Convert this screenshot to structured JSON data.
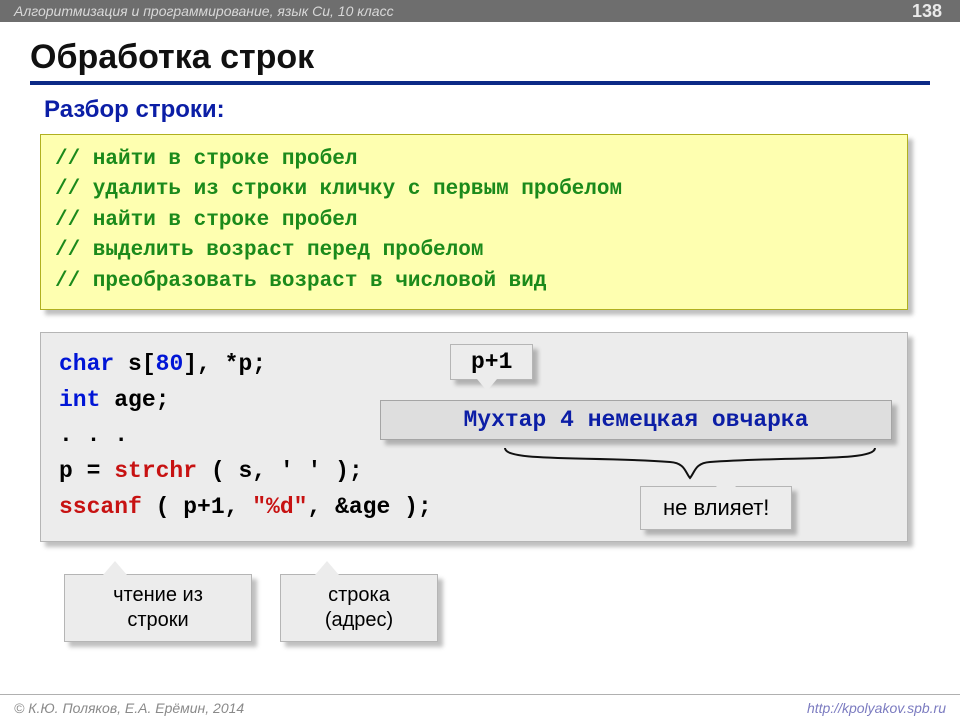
{
  "topbar": {
    "course": "Алгоритмизация и программирование, язык Си, 10 класс",
    "slidenum": "138"
  },
  "title": "Обработка строк",
  "subtitle": "Разбор строки:",
  "comments": [
    "// найти в строке пробел",
    "// удалить из строки кличку с первым пробелом",
    "// найти в строке пробел",
    "// выделить возраст перед пробелом",
    "// преобразовать возраст в числовой вид"
  ],
  "code": {
    "l1_kw1": "char",
    "l1_rest1": " s[",
    "l1_num": "80",
    "l1_rest2": "], *p;",
    "l2_kw": "int",
    "l2_rest": " age;",
    "l3": ". . .",
    "l4_pre": "p = ",
    "l4_fn": "strchr",
    "l4_rest": " ( s, ' ' );",
    "l5_fn": "sscanf",
    "l5_args1": " ( p+1, ",
    "l5_str": "\"%d\"",
    "l5_args2": ", &age );"
  },
  "callouts": {
    "pp1": "p+1",
    "example": "Мухтар 4 немецкая овчарка",
    "noaff": "не влияет!",
    "read": "чтение из\nстроки",
    "addr": "строка\n(адрес)"
  },
  "footer": {
    "left": "© К.Ю. Поляков, Е.А. Ерёмин, 2014",
    "right": "http://kpolyakov.spb.ru"
  }
}
